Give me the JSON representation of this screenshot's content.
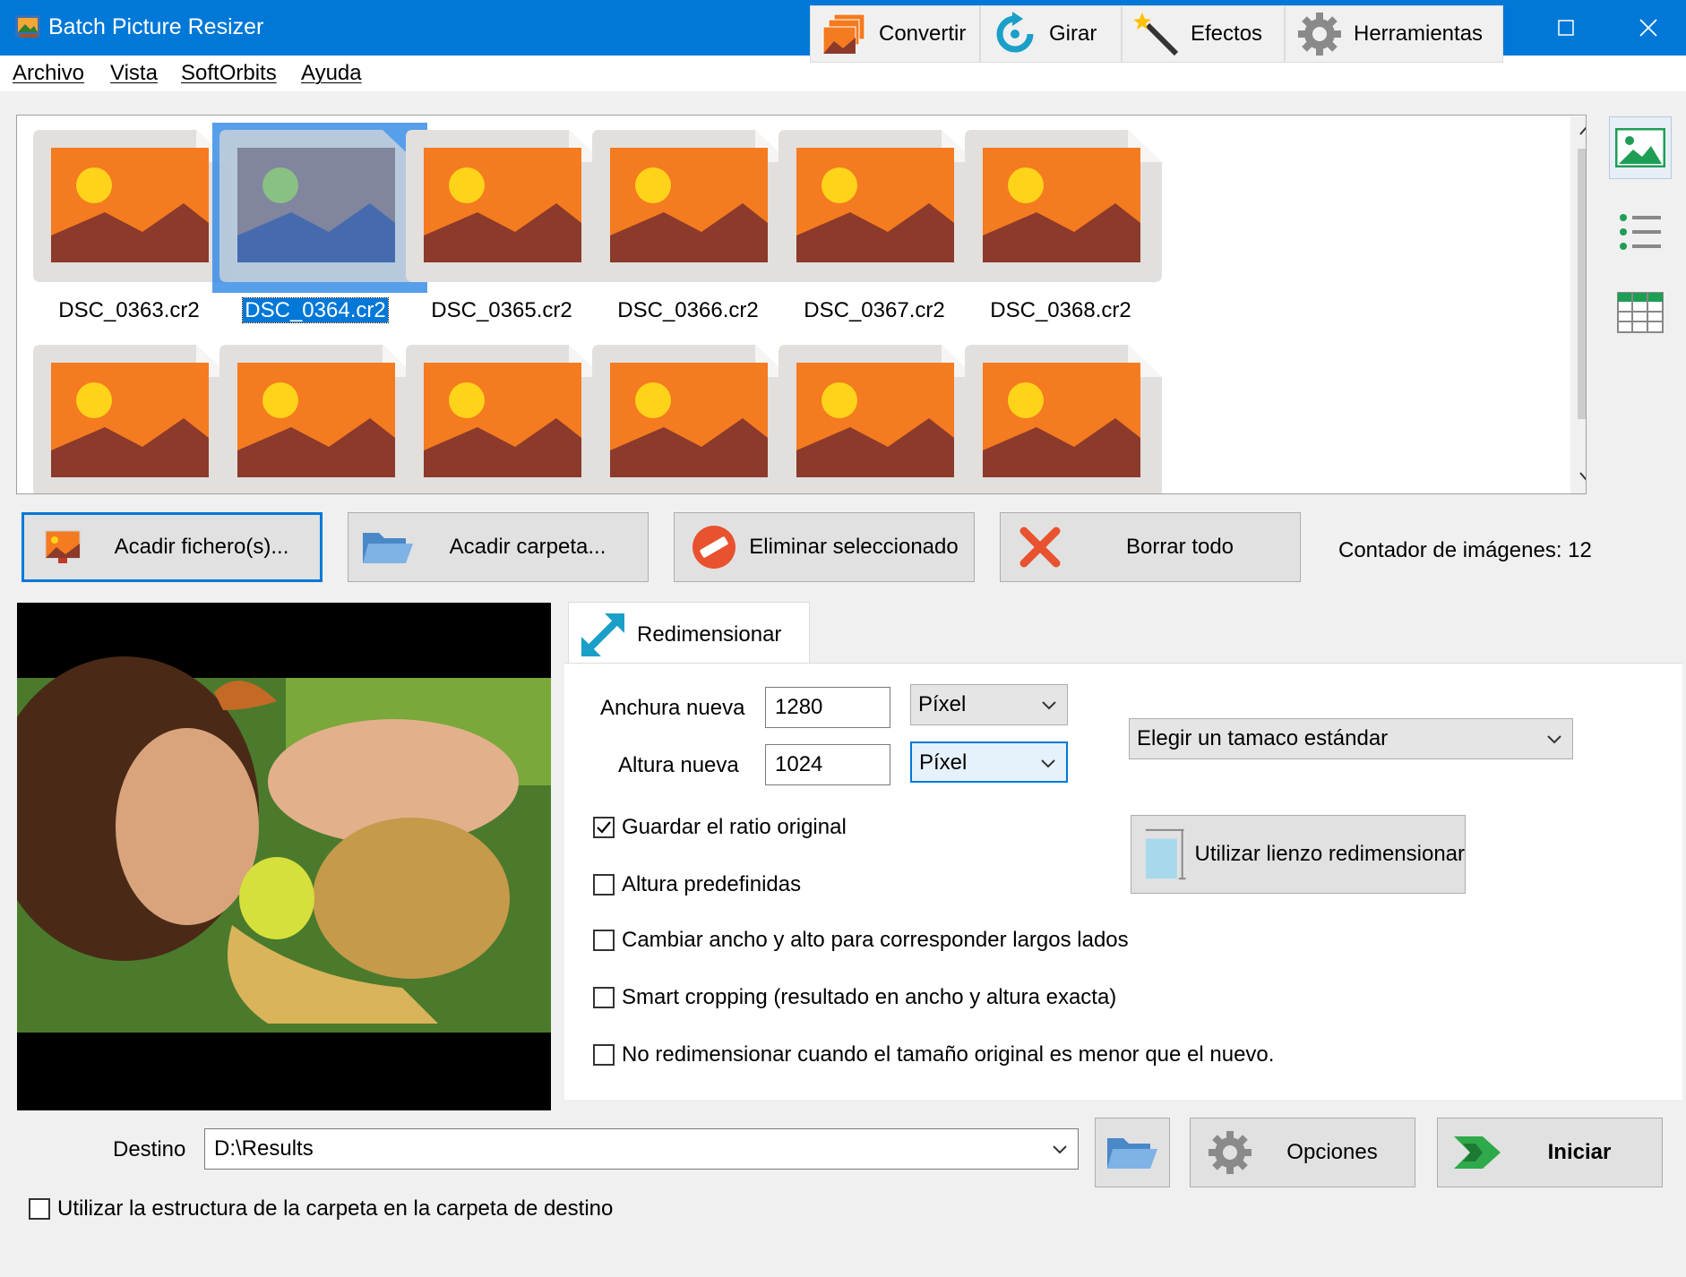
{
  "window": {
    "title": "Batch Picture Resizer",
    "minimize_glyph": "—",
    "maximize_glyph": "☐",
    "close_glyph": "✕"
  },
  "menu": {
    "items": [
      "Archivo",
      "Vista",
      "SoftOrbits",
      "Ayuda"
    ]
  },
  "thumbnails": {
    "row1": [
      "DSC_0363.cr2",
      "DSC_0364.cr2",
      "DSC_0365.cr2",
      "DSC_0366.cr2",
      "DSC_0367.cr2",
      "DSC_0368.cr2"
    ],
    "selected": "DSC_0364.cr2"
  },
  "side_views": {
    "icons": [
      "thumbnails-view-icon",
      "list-view-icon",
      "grid-view-icon"
    ]
  },
  "actions": {
    "add_files": "Acadir fichero(s)...",
    "add_folder": "Acadir carpeta...",
    "remove_selected": "Eliminar seleccionado",
    "clear_all": "Borrar todo",
    "counter_label": "Contador de imágenes: 12"
  },
  "tabs": {
    "resize": "Redimensionar",
    "convert": "Convertir",
    "rotate": "Girar",
    "effects": "Efectos",
    "tools": "Herramientas",
    "active": "Redimensionar"
  },
  "resize": {
    "width_label": "Anchura nueva",
    "width_value": "1280",
    "width_unit": "Píxel",
    "height_label": "Altura nueva",
    "height_value": "1024",
    "height_unit": "Píxel",
    "standard_size": "Elegir un tamaco estándar",
    "keep_ratio": "Guardar el ratio original",
    "keep_ratio_checked": true,
    "predefined_height": "Altura predefinidas",
    "swap_sides": "Cambiar ancho y alto para corresponder largos lados",
    "smart_crop": "Smart cropping (resultado en ancho y altura exacta)",
    "no_upscale": "No redimensionar cuando el tamaño original es menor que el nuevo.",
    "canvas_button": "Utilizar lienzo redimensionar"
  },
  "bottom": {
    "dest_label": "Destino",
    "dest_value": "D:\\Results",
    "options": "Opciones",
    "start": "Iniciar",
    "keep_structure": "Utilizar la estructura de la carpeta en la carpeta de destino"
  },
  "colors": {
    "titlebar": "#0078d7",
    "accent": "#0078d7",
    "thumb_orange": "#f47b20",
    "thumb_brown": "#8b3a2b",
    "thumb_sun": "#ffd319"
  }
}
